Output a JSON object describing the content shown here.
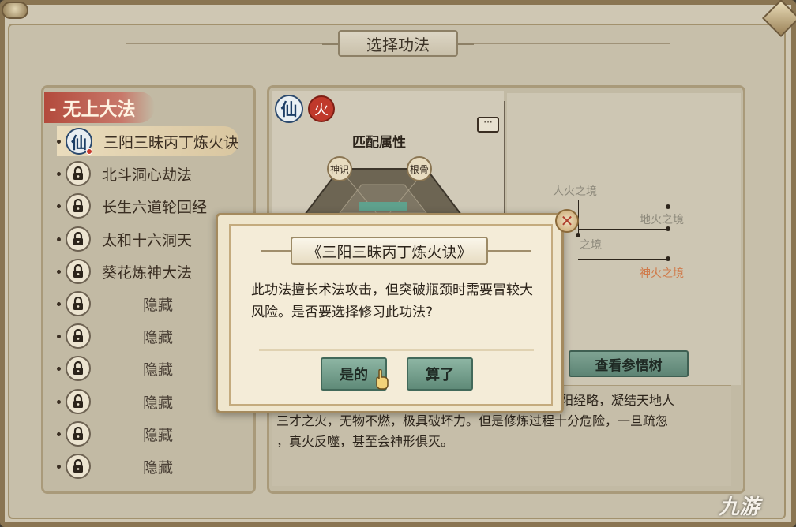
{
  "header": {
    "title": "选择功法"
  },
  "left_panel": {
    "category": "- 无上大法",
    "items": [
      {
        "label": "三阳三昧丙丁炼火诀",
        "icon": "xian-icon",
        "selected": true
      },
      {
        "label": "北斗洞心劫法",
        "icon": "lock-icon"
      },
      {
        "label": "长生六道轮回经",
        "icon": "lock-icon"
      },
      {
        "label": "太和十六洞天",
        "icon": "lock-icon"
      },
      {
        "label": "葵花炼神大法",
        "icon": "lock-icon"
      },
      {
        "label": "隐藏",
        "icon": "lock-icon"
      },
      {
        "label": "隐藏",
        "icon": "lock-icon"
      },
      {
        "label": "隐藏",
        "icon": "lock-icon"
      },
      {
        "label": "隐藏",
        "icon": "lock-icon"
      },
      {
        "label": "隐藏",
        "icon": "lock-icon"
      },
      {
        "label": "隐藏",
        "icon": "lock-icon"
      }
    ]
  },
  "detail": {
    "badge_xian": "仙",
    "badge_fire": "火",
    "attr_title": "匹配属性",
    "attr_node_1": "神识",
    "attr_node_2": "根骨",
    "tree": {
      "label_1": "人火之境",
      "label_2": "地火之境",
      "label_3": "之境",
      "label_4": "神火之境"
    },
    "tree_button": "查看参悟树",
    "description_1": "阳三阳经略，凝结天地人",
    "description_2": "三才之火，无物不燃，极具破坏力。但是修炼过程十分危险，一旦疏忽",
    "description_3": "，真火反噬，甚至会神形俱灭。"
  },
  "modal": {
    "title": "《三阳三昧丙丁炼火诀》",
    "message": "此功法擅长术法攻击，但突破瓶颈时需要冒较大风险。是否要选择修习此功法?",
    "confirm_label": "是的",
    "cancel_label": "算了",
    "close_symbol": "✕"
  },
  "watermark": "九游",
  "colors": {
    "confirm_button": "#6f9c88",
    "fire_badge": "#c0392b",
    "category_header": "#b34a3c"
  }
}
